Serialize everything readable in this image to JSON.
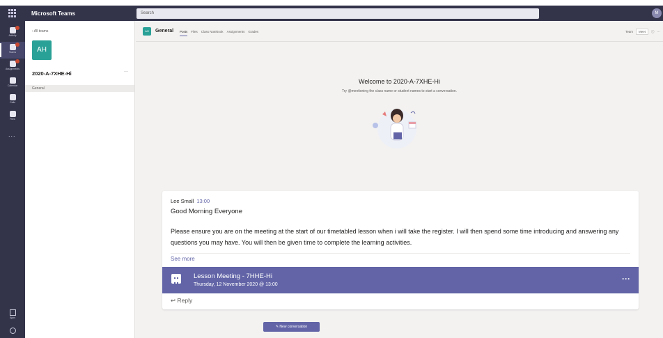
{
  "app": {
    "title": "Microsoft Teams",
    "avatar_initials": "M"
  },
  "search": {
    "placeholder": "Search"
  },
  "rail": {
    "items": [
      {
        "label": "Activity",
        "icon": "bell-icon"
      },
      {
        "label": "Teams",
        "icon": "teams-icon"
      },
      {
        "label": "Assignments",
        "icon": "assignments-icon"
      },
      {
        "label": "Calendar",
        "icon": "calendar-icon"
      },
      {
        "label": "Calls",
        "icon": "phone-icon"
      },
      {
        "label": "Files",
        "icon": "files-icon"
      }
    ],
    "more": "...",
    "apps_label": "Apps",
    "help_label": "Help"
  },
  "team": {
    "back_label": "All teams",
    "avatar": "AH",
    "name": "2020-A-7XHE-Hi",
    "more": "···",
    "channels": [
      "General"
    ]
  },
  "channel": {
    "icon_text": "AH",
    "name": "General",
    "tabs": [
      "Posts",
      "Files",
      "Class Notebook",
      "Assignments",
      "Grades"
    ],
    "header_buttons": [
      "Team",
      "Meet"
    ]
  },
  "welcome": {
    "title": "Welcome to 2020-A-7XHE-Hi",
    "subtitle": "Try @mentioning the class name or student names to start a conversation."
  },
  "post": {
    "author": "Lee Small",
    "time": "13:00",
    "greeting": "Good Morning Everyone",
    "body": "Please ensure you are on the meeting at the start of our timetabled lesson when i will take the register. I will then spend some time introducing and answering any questions you may have. You will then be given time to complete the learning activities.",
    "see_more": "See more",
    "meeting": {
      "title": "Lesson Meeting - 7HHE-Hi",
      "date": "Thursday, 12 November 2020 @ 13:00",
      "more": "···"
    },
    "reply": "Reply"
  },
  "new_conversation": "New conversation",
  "colors": {
    "rail": "#33344a",
    "accent": "#6264a7",
    "team_avatar": "#2aa197"
  }
}
